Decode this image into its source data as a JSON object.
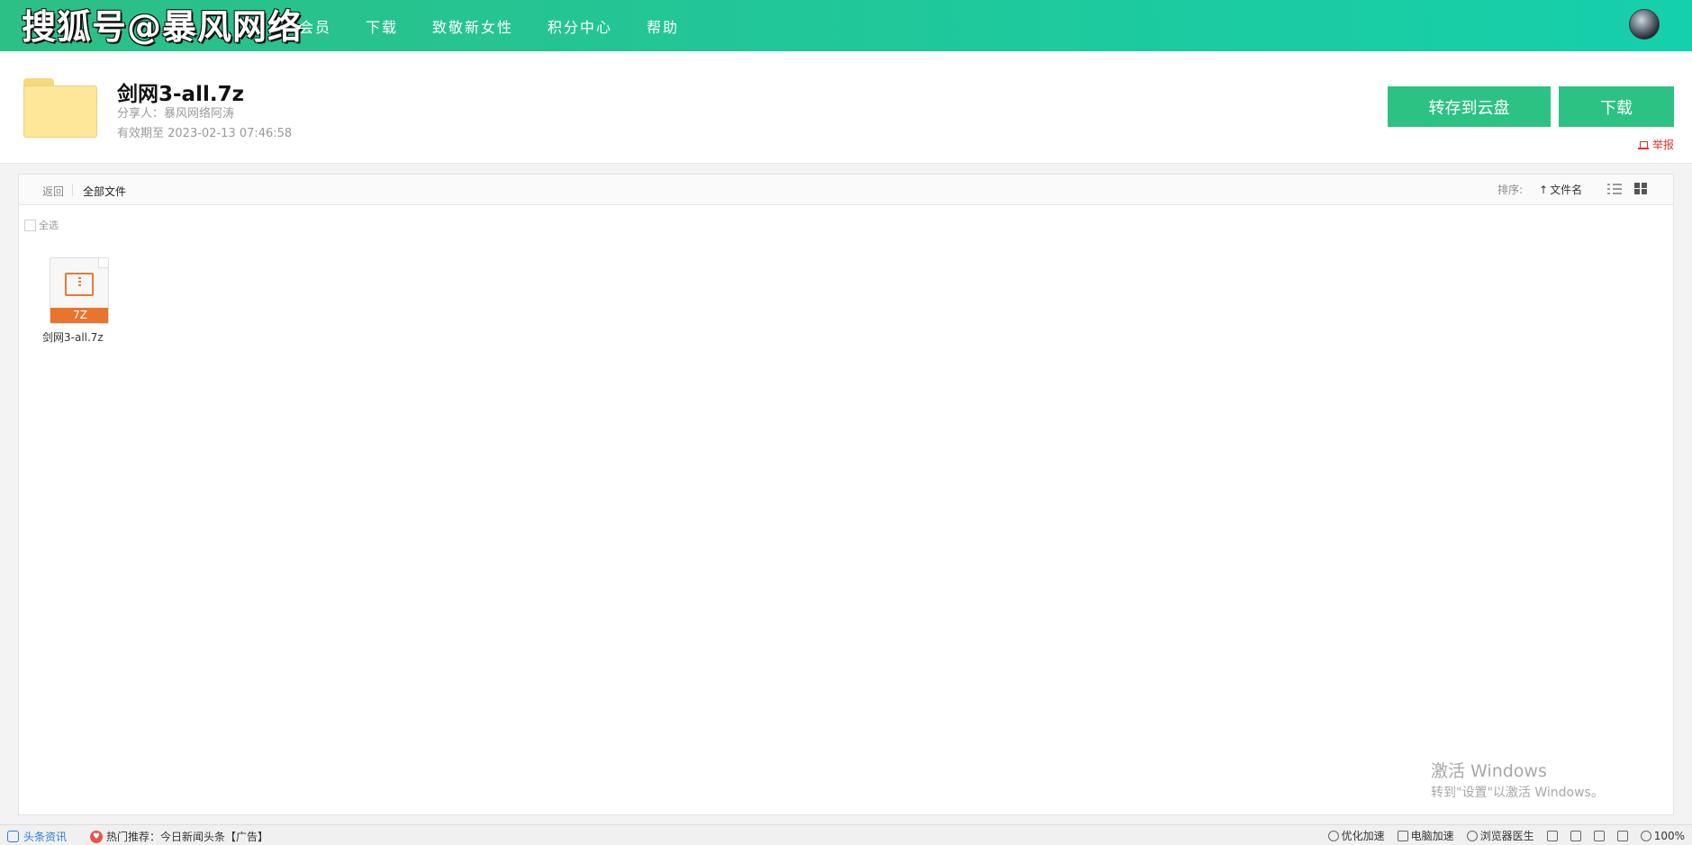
{
  "brand": {
    "watermark": "搜狐号@暴风网络"
  },
  "nav": {
    "items": [
      "会员",
      "下载",
      "致敬新女性",
      "积分中心",
      "帮助"
    ]
  },
  "share": {
    "title": "剑网3-all.7z",
    "sharer": "分享人：暴风网络阿涛",
    "expiry": "有效期至 2023-02-13 07:46:58",
    "save_label": "转存到云盘",
    "download_label": "下载",
    "report_label": "举报"
  },
  "toolbar": {
    "back_label": "返回",
    "all_files_label": "全部文件",
    "sort_label": "排序:",
    "sort_field": "文件名"
  },
  "files": {
    "select_all_label": "全选",
    "items": [
      {
        "name": "剑网3-all.7z",
        "type_badge": "7Z",
        "icon": "zip-file-icon"
      }
    ]
  },
  "windows_activation": {
    "title": "激活 Windows",
    "subtitle": "转到\"设置\"以激活 Windows。"
  },
  "statusbar": {
    "news_label": "头条资讯",
    "hot_label": "热门推荐：今日新闻头条【广告】",
    "optimize_label": "优化加速",
    "pc_speed_label": "电脑加速",
    "browser_doctor_label": "浏览器医生",
    "zoom_label": "100%"
  },
  "colors": {
    "accent": "#2cc283",
    "nav_gradient_start": "#2cbf86",
    "nav_gradient_end": "#15d0ac",
    "report": "#e0322b",
    "zip": "#e8742e"
  }
}
